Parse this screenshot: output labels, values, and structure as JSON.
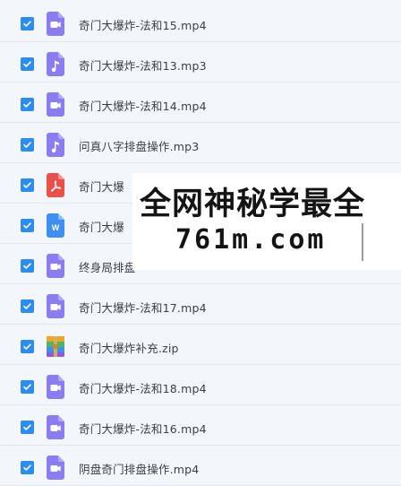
{
  "files": [
    {
      "name": "奇门大爆炸-法和15.mp4",
      "icon": "video-file-icon",
      "checked": true
    },
    {
      "name": "奇门大爆炸-法和13.mp3",
      "icon": "audio-file-icon",
      "checked": true
    },
    {
      "name": "奇门大爆炸-法和14.mp4",
      "icon": "video-file-icon",
      "checked": true
    },
    {
      "name": "问真八字排盘操作.mp3",
      "icon": "audio-file-icon",
      "checked": true
    },
    {
      "name": "奇门大爆",
      "icon": "pdf-file-icon",
      "checked": true
    },
    {
      "name": "奇门大爆",
      "icon": "word-file-icon",
      "checked": true
    },
    {
      "name": "终身局排盘",
      "icon": "video-file-icon",
      "checked": true
    },
    {
      "name": "奇门大爆炸-法和17.mp4",
      "icon": "video-file-icon",
      "checked": true
    },
    {
      "name": "奇门大爆炸补充.zip",
      "icon": "zip-file-icon",
      "checked": true
    },
    {
      "name": "奇门大爆炸-法和18.mp4",
      "icon": "video-file-icon",
      "checked": true
    },
    {
      "name": "奇门大爆炸-法和16.mp4",
      "icon": "video-file-icon",
      "checked": true
    },
    {
      "name": "阴盘奇门排盘操作.mp4",
      "icon": "video-file-icon",
      "checked": true
    }
  ],
  "watermark": {
    "line1": "全网神秘学最全",
    "line2": "761m.com"
  },
  "colors": {
    "checkbox": "#2d8cf0",
    "media_icon": "#8b7cf0",
    "pdf_icon": "#e8504a",
    "word_icon": "#3f8ef2"
  }
}
